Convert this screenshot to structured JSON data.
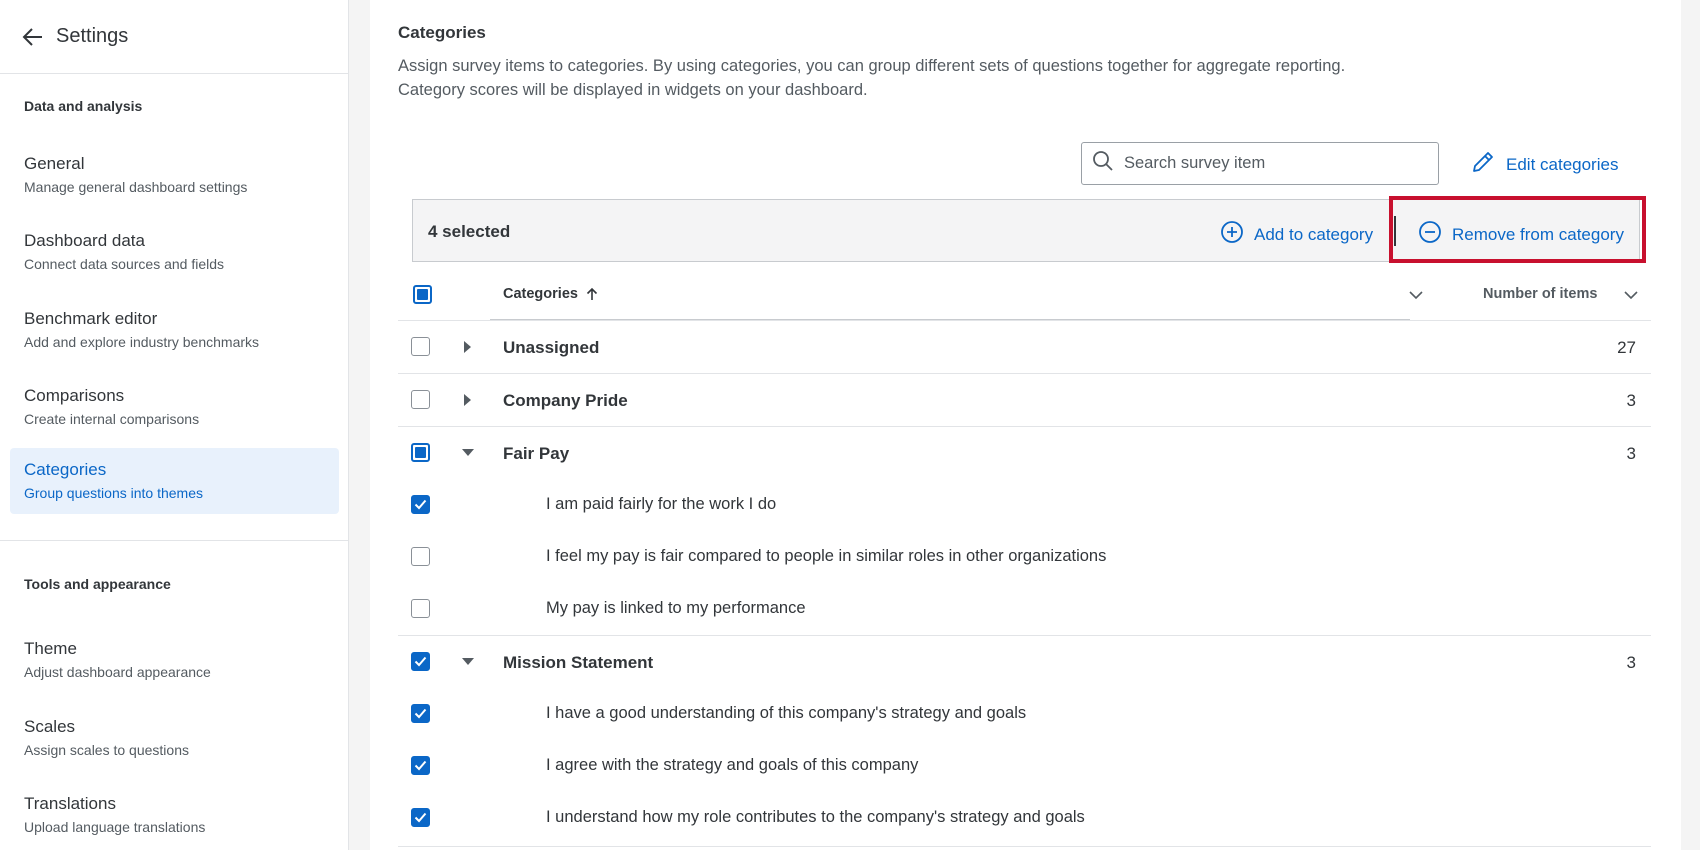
{
  "sidebar": {
    "title": "Settings",
    "sections": [
      {
        "label": "Data and analysis"
      },
      {
        "label": "Tools and appearance"
      }
    ],
    "items": [
      {
        "label": "General",
        "desc": "Manage general dashboard settings"
      },
      {
        "label": "Dashboard data",
        "desc": "Connect data sources and fields"
      },
      {
        "label": "Benchmark editor",
        "desc": "Add and explore industry benchmarks"
      },
      {
        "label": "Comparisons",
        "desc": "Create internal comparisons"
      },
      {
        "label": "Categories",
        "desc": "Group questions into themes"
      },
      {
        "label": "Theme",
        "desc": "Adjust dashboard appearance"
      },
      {
        "label": "Scales",
        "desc": "Assign scales to questions"
      },
      {
        "label": "Translations",
        "desc": "Upload language translations"
      }
    ],
    "active_index": 4
  },
  "main": {
    "title": "Categories",
    "description_line1": "Assign survey items to categories. By using categories, you can group different sets of questions together for aggregate reporting.",
    "description_line2": "Category scores will be displayed in widgets on your dashboard.",
    "search_placeholder": "Search survey item",
    "edit_categories_label": "Edit categories",
    "selection": {
      "count_label": "4 selected",
      "add_label": "Add to category",
      "remove_label": "Remove from category"
    },
    "table": {
      "col_categories": "Categories",
      "col_number": "Number of items",
      "rows": [
        {
          "type": "group",
          "name": "Unassigned",
          "count": "27",
          "check": "unchecked",
          "expanded": false
        },
        {
          "type": "group",
          "name": "Company Pride",
          "count": "3",
          "check": "unchecked",
          "expanded": false
        },
        {
          "type": "group",
          "name": "Fair Pay",
          "count": "3",
          "check": "indeterminate",
          "expanded": true
        },
        {
          "type": "item",
          "text": "I am paid fairly for the work I do",
          "check": "checked"
        },
        {
          "type": "item",
          "text": "I feel my pay is fair compared to people in similar roles in other organizations",
          "check": "unchecked"
        },
        {
          "type": "item",
          "text": "My pay is linked to my performance",
          "check": "unchecked"
        },
        {
          "type": "group",
          "name": "Mission Statement",
          "count": "3",
          "check": "checked",
          "expanded": true
        },
        {
          "type": "item",
          "text": "I have a good understanding of this company's strategy and goals",
          "check": "checked"
        },
        {
          "type": "item",
          "text": "I agree with the strategy and goals of this company",
          "check": "checked"
        },
        {
          "type": "item",
          "text": "I understand how my role contributes to the company's strategy and goals",
          "check": "checked"
        }
      ]
    }
  },
  "colors": {
    "accent": "#0b67c7",
    "highlight": "#c8102e",
    "active_bg": "#e8f1fc"
  }
}
